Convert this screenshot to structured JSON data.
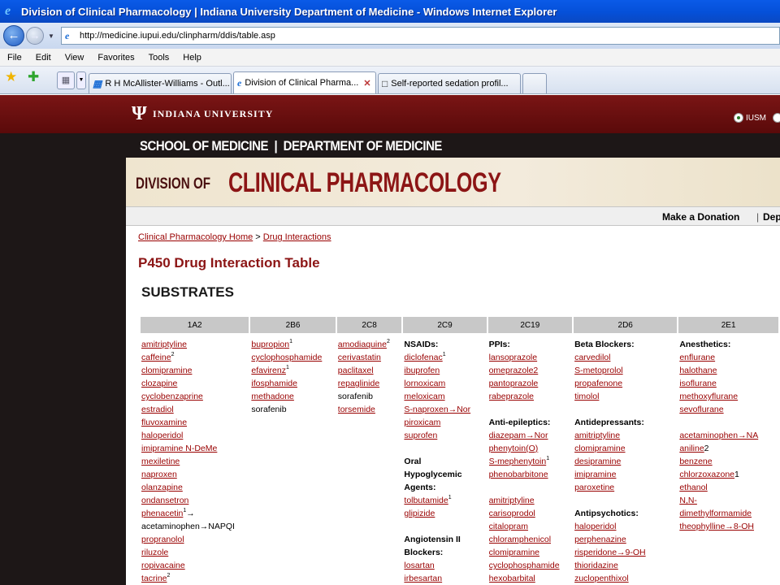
{
  "window": {
    "title": "Division of Clinical Pharmacology | Indiana University Department of Medicine - Windows Internet Explorer"
  },
  "address": {
    "url": "http://medicine.iupui.edu/clinpharm/ddis/table.asp"
  },
  "menu": [
    "File",
    "Edit",
    "View",
    "Favorites",
    "Tools",
    "Help"
  ],
  "tabs": [
    {
      "label": "R H McAllister-Williams - Outl..."
    },
    {
      "label": "Division of Clinical Pharma..."
    },
    {
      "label": "Self-reported sedation profil..."
    }
  ],
  "header": {
    "university": "INDIANA UNIVERSITY",
    "radio_label": "IUSM",
    "school_line": "SCHOOL OF MEDICINE  |  DEPARTMENT OF MEDICINE",
    "banner_prefix": "DIVISION OF",
    "banner_main": "CLINICAL PHARMACOLOGY",
    "donation": "Make a Donation",
    "donation_sep": "|",
    "donation_next": "Dep"
  },
  "breadcrumb": {
    "home": "Clinical Pharmacology Home",
    "sep": " > ",
    "current": "Drug Interactions"
  },
  "page_title": "P450 Drug Interaction Table",
  "section_title": "SUBSTRATES",
  "table": {
    "columns": [
      "1A2",
      "2B6",
      "2C8",
      "2C9",
      "2C19",
      "2D6",
      "2E1"
    ],
    "cells": [
      [
        {
          "t": "amitriptyline",
          "link": true
        },
        {
          "t": "caffeine",
          "link": true,
          "sup": "2"
        },
        {
          "t": "clomipramine",
          "link": true
        },
        {
          "t": "clozapine",
          "link": true
        },
        {
          "t": "cyclobenzaprine",
          "link": true
        },
        {
          "t": "estradiol",
          "link": true
        },
        {
          "t": "fluvoxamine",
          "link": true
        },
        {
          "t": "haloperidol",
          "link": true
        },
        {
          "t": "imipramine N-DeMe",
          "link": true
        },
        {
          "t": "mexiletine",
          "link": true
        },
        {
          "t": "naproxen",
          "link": true
        },
        {
          "t": "olanzapine",
          "link": true
        },
        {
          "t": "ondansetron",
          "link": true
        },
        {
          "t": "phenacetin",
          "link": true,
          "sup": "1",
          "after": "→"
        },
        {
          "t": "acetaminophen→NAPQI"
        },
        {
          "t": "propranolol",
          "link": true
        },
        {
          "t": "riluzole",
          "link": true
        },
        {
          "t": "ropivacaine",
          "link": true
        },
        {
          "t": "tacrine",
          "link": true,
          "sup": "2"
        }
      ],
      [
        {
          "t": "bupropion",
          "link": true,
          "sup": "1"
        },
        {
          "t": "cyclophosphamide",
          "link": true
        },
        {
          "t": "efavirenz",
          "link": true,
          "sup": "1"
        },
        {
          "t": "ifosphamide",
          "link": true
        },
        {
          "t": "methadone",
          "link": true
        },
        {
          "t": "sorafenib"
        }
      ],
      [
        {
          "t": "amodiaquine",
          "link": true,
          "sup": "2"
        },
        {
          "t": "cerivastatin",
          "link": true
        },
        {
          "t": "paclitaxel",
          "link": true
        },
        {
          "t": "repaglinide",
          "link": true
        },
        {
          "t": "sorafenib"
        },
        {
          "t": "torsemide",
          "link": true
        }
      ],
      [
        {
          "t": "NSAIDs:",
          "bold": true
        },
        {
          "t": "diclofenac",
          "link": true,
          "sup": "1"
        },
        {
          "t": "ibuprofen",
          "link": true
        },
        {
          "t": "lornoxicam",
          "link": true
        },
        {
          "t": "meloxicam",
          "link": true
        },
        {
          "t": "S-naproxen→Nor",
          "link": true
        },
        {
          "t": "piroxicam",
          "link": true
        },
        {
          "t": "suprofen",
          "link": true
        },
        {
          "t": ""
        },
        {
          "t": "Oral",
          "bold": true
        },
        {
          "t": "Hypoglycemic",
          "bold": true
        },
        {
          "t": "Agents:",
          "bold": true
        },
        {
          "t": "tolbutamide",
          "link": true,
          "sup": "1"
        },
        {
          "t": "glipizide",
          "link": true
        },
        {
          "t": ""
        },
        {
          "t": "Angiotensin II",
          "bold": true
        },
        {
          "t": "Blockers:",
          "bold": true
        },
        {
          "t": "losartan",
          "link": true
        },
        {
          "t": "irbesartan",
          "link": true
        }
      ],
      [
        {
          "t": "PPIs:",
          "bold": true
        },
        {
          "t": "lansoprazole",
          "link": true
        },
        {
          "t": "omeprazole2",
          "link": true
        },
        {
          "t": "pantoprazole",
          "link": true
        },
        {
          "t": "rabeprazole",
          "link": true
        },
        {
          "t": ""
        },
        {
          "t": "Anti-epileptics:",
          "bold": true
        },
        {
          "t": "diazepam→Nor",
          "link": true
        },
        {
          "t": "phenytoin(O)",
          "link": true
        },
        {
          "t": "S-mephenytoin",
          "link": true,
          "sup": "1"
        },
        {
          "t": "phenobarbitone",
          "link": true
        },
        {
          "t": ""
        },
        {
          "t": "amitriptyline",
          "link": true
        },
        {
          "t": "carisoprodol",
          "link": true
        },
        {
          "t": "citalopram",
          "link": true
        },
        {
          "t": "chloramphenicol",
          "link": true
        },
        {
          "t": "clomipramine",
          "link": true
        },
        {
          "t": "cyclophosphamide",
          "link": true
        },
        {
          "t": "hexobarbital",
          "link": true
        }
      ],
      [
        {
          "t": "Beta Blockers:",
          "bold": true
        },
        {
          "t": "carvedilol",
          "link": true
        },
        {
          "t": "S-metoprolol",
          "link": true
        },
        {
          "t": "propafenone",
          "link": true
        },
        {
          "t": "timolol",
          "link": true
        },
        {
          "t": ""
        },
        {
          "t": "Antidepressants:",
          "bold": true
        },
        {
          "t": "amitriptyline",
          "link": true
        },
        {
          "t": "clomipramine",
          "link": true
        },
        {
          "t": "desipramine",
          "link": true
        },
        {
          "t": "imipramine",
          "link": true
        },
        {
          "t": "paroxetine",
          "link": true
        },
        {
          "t": ""
        },
        {
          "t": "Antipsychotics:",
          "bold": true
        },
        {
          "t": "haloperidol",
          "link": true
        },
        {
          "t": "perphenazine",
          "link": true
        },
        {
          "t": "risperidone→9-OH",
          "link": true
        },
        {
          "t": "thioridazine",
          "link": true
        },
        {
          "t": "zuclopenthixol",
          "link": true
        }
      ],
      [
        {
          "t": "Anesthetics:",
          "bold": true
        },
        {
          "t": "enflurane",
          "link": true
        },
        {
          "t": "halothane",
          "link": true
        },
        {
          "t": "isoflurane",
          "link": true
        },
        {
          "t": "methoxyflurane",
          "link": true
        },
        {
          "t": "sevoflurane",
          "link": true
        },
        {
          "t": ""
        },
        {
          "t": "acetaminophen→NA",
          "link": true
        },
        {
          "t": "aniline",
          "link": true,
          "after": "2"
        },
        {
          "t": "benzene",
          "link": true
        },
        {
          "t": "chlorzoxazone",
          "link": true,
          "after": "1"
        },
        {
          "t": "ethanol",
          "link": true
        },
        {
          "t": "N,N-",
          "link": true
        },
        {
          "t": "dimethylformamide",
          "link": true
        },
        {
          "t": "theophylline→8-OH",
          "link": true
        }
      ]
    ]
  }
}
